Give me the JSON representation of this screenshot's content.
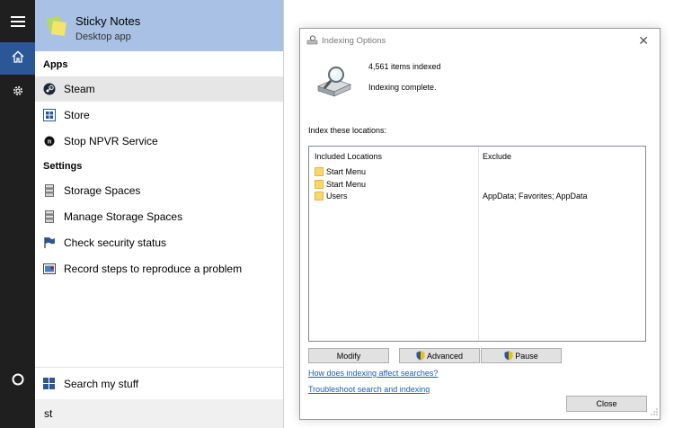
{
  "start_menu": {
    "best_match": {
      "title": "Sticky Notes",
      "subtitle": "Desktop app"
    },
    "groups": [
      {
        "heading": "Apps"
      },
      {
        "heading": "Settings"
      }
    ],
    "apps": [
      {
        "label": "Steam",
        "icon": "steam-icon",
        "highlighted": true
      },
      {
        "label": "Store",
        "icon": "store-icon"
      },
      {
        "label": "Stop NPVR Service",
        "icon": "service-icon"
      }
    ],
    "settings": [
      {
        "label": "Storage Spaces",
        "icon": "storage-icon"
      },
      {
        "label": "Manage Storage Spaces",
        "icon": "storage-icon"
      },
      {
        "label": "Check security status",
        "icon": "flag-icon"
      },
      {
        "label": "Record steps to reproduce a problem",
        "icon": "recorder-icon"
      }
    ],
    "search_my_stuff": "Search my stuff",
    "query": "st"
  },
  "indexing_dialog": {
    "title": "Indexing Options",
    "items_indexed": "4,561 items indexed",
    "status": "Indexing complete.",
    "locations_label": "Index these locations:",
    "columns": {
      "included": "Included Locations",
      "exclude": "Exclude"
    },
    "rows": [
      {
        "location": "Start Menu",
        "exclude": ""
      },
      {
        "location": "Start Menu",
        "exclude": ""
      },
      {
        "location": "Users",
        "exclude": "AppData; Favorites; AppData"
      }
    ],
    "buttons": {
      "modify": "Modify",
      "advanced": "Advanced",
      "pause": "Pause",
      "close": "Close"
    },
    "links": {
      "how": "How does indexing affect searches?",
      "troubleshoot": "Troubleshoot search and indexing"
    }
  },
  "colors": {
    "accent": "#2b5797",
    "best_match_bg": "#a9c1e4",
    "rail_bg": "#1f1f1f",
    "link": "#1a5fb4"
  }
}
